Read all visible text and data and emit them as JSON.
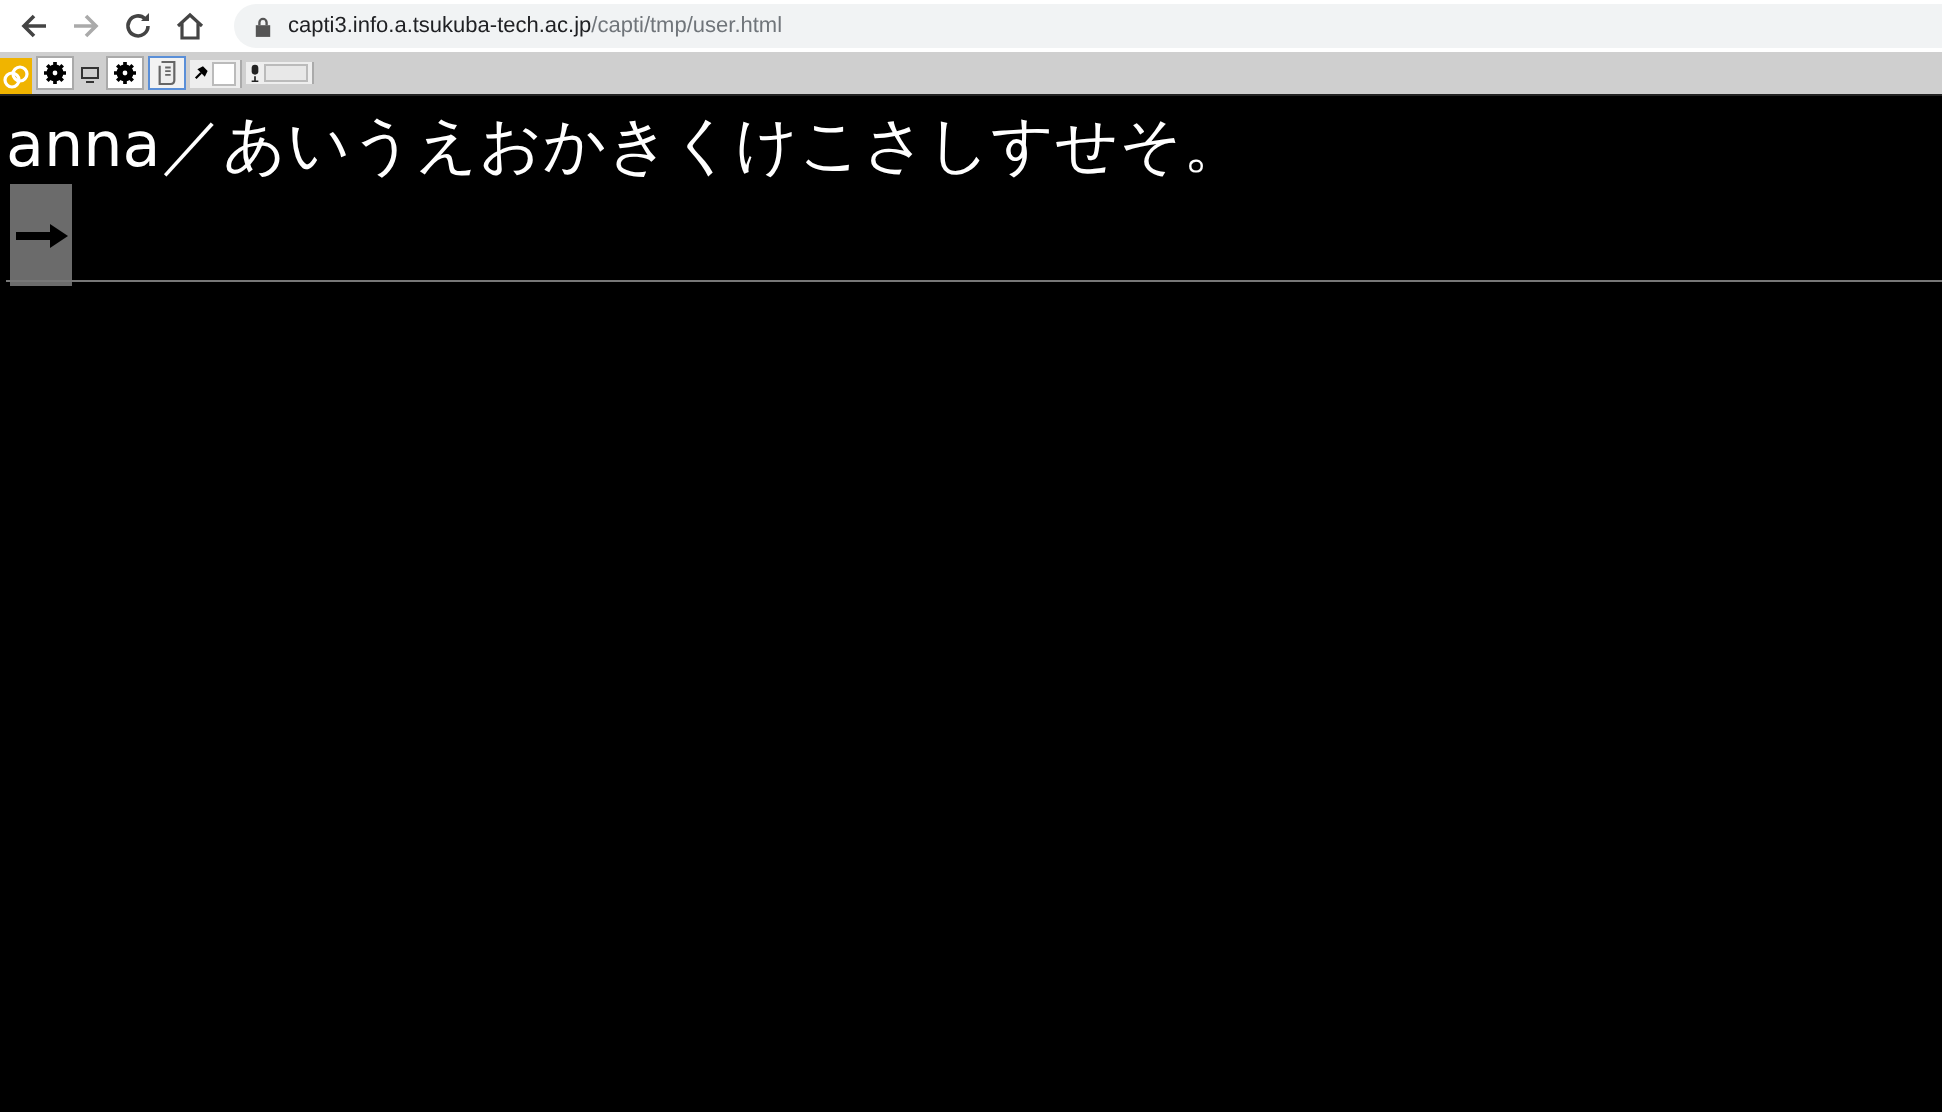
{
  "browser": {
    "url_host": "capti3.info.a.tsukuba-tech.ac.jp",
    "url_path": "/capti/tmp/user.html"
  },
  "toolbar": {
    "buttons": [
      {
        "kind": "gear",
        "selected": false
      },
      {
        "kind": "screen-gear",
        "selected": false
      },
      {
        "kind": "scroll",
        "selected": true
      }
    ],
    "pin": {
      "checked": false
    }
  },
  "content": {
    "heading": "anna／あいうえおかきくけこさしすせそ。"
  }
}
